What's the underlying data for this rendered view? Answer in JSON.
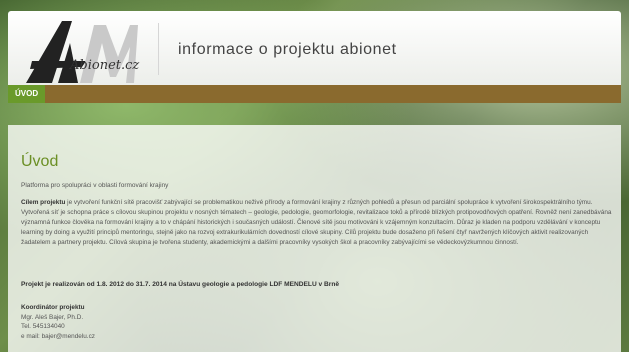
{
  "header": {
    "logo_text": "Abionet.cz",
    "site_title": "informace o projektu abionet"
  },
  "nav": {
    "items": [
      {
        "label": "ÚVOD"
      }
    ]
  },
  "main": {
    "title": "Úvod",
    "subtitle": "Platforma pro spolupráci v oblasti formování krajiny",
    "intro_bold": "Cílem projektu",
    "intro_text": " je vytvoření funkční sítě pracovišť zabývající se problematikou neživé přírody a formování krajiny z různých pohledů a přesun od parciální spolupráce k vytvoření širokospektrálního týmu. Vytvořená síť je schopna práce s cílovou skupinou projektu v nosných tématech – geologie, pedologie, geomorfologie, revitalizace toků a přírodě blízkých protipovodňových opatření. Rovněž není zanedbávána významná funkce člověka na formování krajiny a to v chápání historických i současných událostí. Členové sítě jsou motivováni k vzájemným konzultacím. Důraz je kladen na podporu vzdělávání v konceptu learning by doing a využití principů mentoringu, stejně jako na rozvoj extrakurikulárních dovedností cílové skupiny. Cílů projektu bude dosaženo při řešení čtyř navržených klíčových aktivit realizovaných žadatelem a partnery projektu. Cílová skupina je tvořena studenty, akademickými a dalšími pracovníky vysokých škol a pracovníky zabývajícími se vědeckovýzkumnou činností.",
    "realization": "Projekt je realizován od 1.8. 2012 do 31.7. 2014 na Ústavu geologie a pedologie LDF MENDELU v Brně",
    "coordinator": {
      "heading": "Koordinátor projektu",
      "name": "Mgr. Aleš Bajer, Ph.D.",
      "phone": "Tel. 545134040",
      "email": "e mail: bajer@mendelu.cz"
    }
  },
  "colors": {
    "nav_bar": "#8a6a2e",
    "nav_active": "#6a9a2a",
    "title_green": "#6b8f25"
  }
}
